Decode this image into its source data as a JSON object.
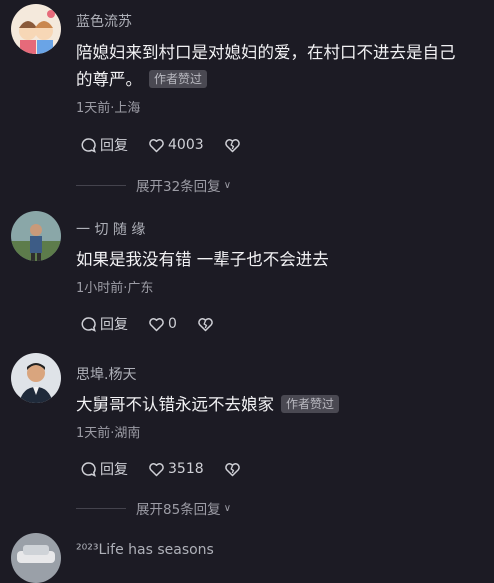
{
  "comments": [
    {
      "username": "蓝色流苏",
      "text": "陪媳妇来到村口是对媳妇的爱，在村口不进去是自己",
      "text2": "的尊严。",
      "badge": "作者赞过",
      "meta": "1天前·上海",
      "reply_label": "回复",
      "likes": "4003",
      "expand": "展开32条回复"
    },
    {
      "username": "一 切 随 缘",
      "text": "如果是我没有错 一辈子也不会进去",
      "meta": "1小时前·广东",
      "reply_label": "回复",
      "likes": "0"
    },
    {
      "username": "思埠.杨天",
      "text": "大舅哥不认错永远不去娘家",
      "badge": "作者赞过",
      "meta": "1天前·湖南",
      "reply_label": "回复",
      "likes": "3518",
      "expand": "展开85条回复"
    },
    {
      "username": "²⁰²³Life has seasons"
    }
  ],
  "colors": {
    "background": "#1c1b24",
    "badge_bg": "#4a4952",
    "meta": "#9c9ca5"
  },
  "icons": [
    "comment-bubble-icon",
    "heart-icon",
    "broken-heart-icon",
    "chevron-down-icon"
  ]
}
